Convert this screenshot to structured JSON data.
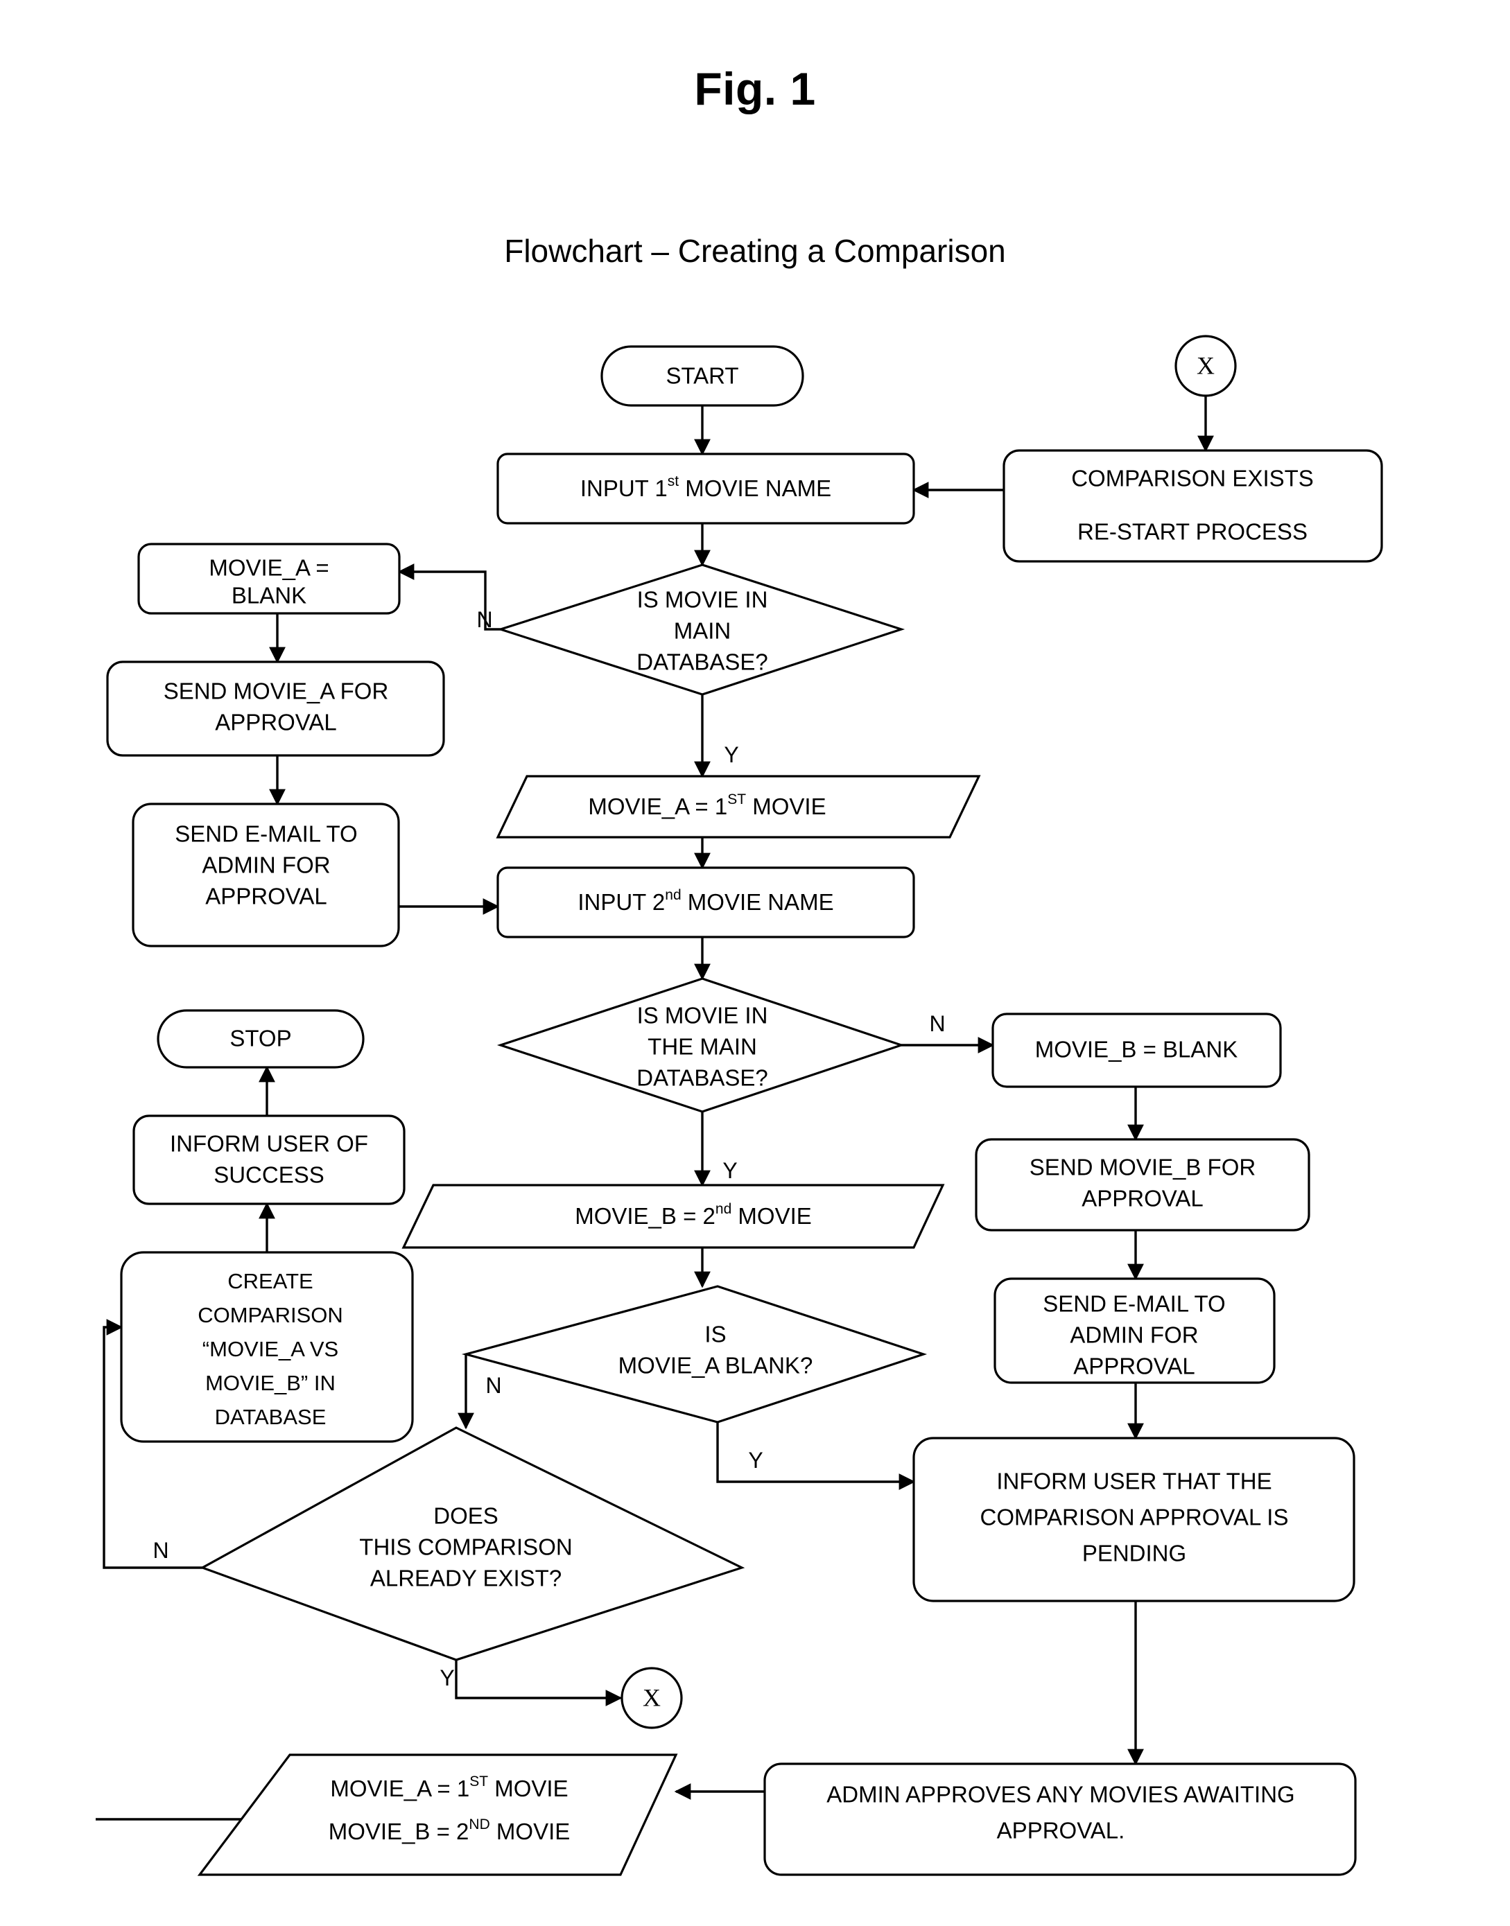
{
  "figure": {
    "label": "Fig. 1",
    "title": "Flowchart – Creating a Comparison"
  },
  "chart_data": {
    "type": "diagram",
    "diagram_kind": "flowchart",
    "title": "Flowchart – Creating a Comparison",
    "figure_label": "Fig. 1",
    "nodes": [
      {
        "id": "start",
        "shape": "terminator",
        "text": "START"
      },
      {
        "id": "connector_x_top",
        "shape": "connector",
        "text": "X"
      },
      {
        "id": "input1",
        "shape": "process",
        "text": "INPUT 1st MOVIE NAME"
      },
      {
        "id": "comparison_exists",
        "shape": "process",
        "text": "COMPARISON EXISTS\nRE-START PROCESS"
      },
      {
        "id": "dec_movie_main_1",
        "shape": "decision",
        "text": "IS MOVIE IN MAIN DATABASE?"
      },
      {
        "id": "movie_a_blank",
        "shape": "process",
        "text": "MOVIE_A = BLANK"
      },
      {
        "id": "send_a_approval",
        "shape": "process",
        "text": "SEND MOVIE_A FOR APPROVAL"
      },
      {
        "id": "email_admin_a",
        "shape": "process",
        "text": "SEND E-MAIL TO ADMIN FOR APPROVAL"
      },
      {
        "id": "assign_a",
        "shape": "data",
        "text": "MOVIE_A = 1ST MOVIE"
      },
      {
        "id": "input2",
        "shape": "process",
        "text": "INPUT 2nd MOVIE NAME"
      },
      {
        "id": "dec_movie_main_2",
        "shape": "decision",
        "text": "IS MOVIE IN THE MAIN DATABASE?"
      },
      {
        "id": "movie_b_blank",
        "shape": "process",
        "text": "MOVIE_B = BLANK"
      },
      {
        "id": "send_b_approval",
        "shape": "process",
        "text": "SEND MOVIE_B FOR APPROVAL"
      },
      {
        "id": "email_admin_b",
        "shape": "process",
        "text": "SEND E-MAIL TO ADMIN FOR APPROVAL"
      },
      {
        "id": "assign_b",
        "shape": "data",
        "text": "MOVIE_B = 2nd MOVIE"
      },
      {
        "id": "dec_a_blank",
        "shape": "decision",
        "text": "IS MOVIE_A BLANK?"
      },
      {
        "id": "dec_comparison",
        "shape": "decision",
        "text": "DOES THIS COMPARISON ALREADY EXIST?"
      },
      {
        "id": "create_comparison",
        "shape": "process",
        "text": "CREATE COMPARISON “MOVIE_A VS MOVIE_B” IN DATABASE"
      },
      {
        "id": "inform_success",
        "shape": "process",
        "text": "INFORM USER OF SUCCESS"
      },
      {
        "id": "stop",
        "shape": "terminator",
        "text": "STOP"
      },
      {
        "id": "inform_pending",
        "shape": "process",
        "text": "INFORM USER THAT THE COMPARISON APPROVAL IS PENDING"
      },
      {
        "id": "connector_x_bot",
        "shape": "connector",
        "text": "X"
      },
      {
        "id": "admin_approves",
        "shape": "process",
        "text": "ADMIN APPROVES ANY MOVIES AWAITING APPROVAL."
      },
      {
        "id": "final_assign",
        "shape": "data",
        "text": "MOVIE_A = 1ST MOVIE\nMOVIE_B = 2ND MOVIE"
      }
    ],
    "edges": [
      {
        "from": "start",
        "to": "input1",
        "label": ""
      },
      {
        "from": "connector_x_top",
        "to": "comparison_exists",
        "label": ""
      },
      {
        "from": "comparison_exists",
        "to": "input1",
        "label": ""
      },
      {
        "from": "input1",
        "to": "dec_movie_main_1",
        "label": ""
      },
      {
        "from": "dec_movie_main_1",
        "to": "movie_a_blank",
        "label": "N"
      },
      {
        "from": "dec_movie_main_1",
        "to": "assign_a",
        "label": "Y"
      },
      {
        "from": "movie_a_blank",
        "to": "send_a_approval",
        "label": ""
      },
      {
        "from": "send_a_approval",
        "to": "email_admin_a",
        "label": ""
      },
      {
        "from": "email_admin_a",
        "to": "input2",
        "label": ""
      },
      {
        "from": "assign_a",
        "to": "input2",
        "label": ""
      },
      {
        "from": "input2",
        "to": "dec_movie_main_2",
        "label": ""
      },
      {
        "from": "dec_movie_main_2",
        "to": "movie_b_blank",
        "label": "N"
      },
      {
        "from": "dec_movie_main_2",
        "to": "assign_b",
        "label": "Y"
      },
      {
        "from": "movie_b_blank",
        "to": "send_b_approval",
        "label": ""
      },
      {
        "from": "send_b_approval",
        "to": "email_admin_b",
        "label": ""
      },
      {
        "from": "email_admin_b",
        "to": "inform_pending",
        "label": ""
      },
      {
        "from": "assign_b",
        "to": "dec_a_blank",
        "label": ""
      },
      {
        "from": "dec_a_blank",
        "to": "dec_comparison",
        "label": "N"
      },
      {
        "from": "dec_a_blank",
        "to": "inform_pending",
        "label": "Y"
      },
      {
        "from": "dec_comparison",
        "to": "create_comparison",
        "label": "N"
      },
      {
        "from": "dec_comparison",
        "to": "connector_x_bot",
        "label": "Y"
      },
      {
        "from": "create_comparison",
        "to": "inform_success",
        "label": ""
      },
      {
        "from": "inform_success",
        "to": "stop",
        "label": ""
      },
      {
        "from": "inform_pending",
        "to": "admin_approves",
        "label": ""
      },
      {
        "from": "admin_approves",
        "to": "final_assign",
        "label": ""
      }
    ],
    "branch_labels": [
      "Y",
      "N"
    ]
  },
  "nodes": {
    "start": "START",
    "connector_x_top": "X",
    "connector_x_bottom": "X",
    "input1_pre": "INPUT 1",
    "input1_sup": "st",
    "input1_post": " MOVIE NAME",
    "comparison_exists_l1": "COMPARISON EXISTS",
    "comparison_exists_l2": "RE-START PROCESS",
    "dec1_l1": "IS MOVIE IN",
    "dec1_l2": "MAIN",
    "dec1_l3": "DATABASE?",
    "movie_a_blank_l1": "MOVIE_A =",
    "movie_a_blank_l2": "BLANK",
    "send_a_l1": "SEND MOVIE_A FOR",
    "send_a_l2": "APPROVAL",
    "email_a_l1": "SEND E-MAIL TO",
    "email_a_l2": "ADMIN FOR",
    "email_a_l3": "APPROVAL",
    "assign_a_pre": "MOVIE_A = 1",
    "assign_a_sup": "ST",
    "assign_a_post": " MOVIE",
    "input2_pre": "INPUT 2",
    "input2_sup": "nd",
    "input2_post": " MOVIE NAME",
    "dec2_l1": "IS MOVIE IN",
    "dec2_l2": "THE MAIN",
    "dec2_l3": "DATABASE?",
    "movie_b_blank": "MOVIE_B = BLANK",
    "send_b_l1": "SEND MOVIE_B FOR",
    "send_b_l2": "APPROVAL",
    "email_b_l1": "SEND E-MAIL TO",
    "email_b_l2": "ADMIN FOR",
    "email_b_l3": "APPROVAL",
    "assign_b_pre": "MOVIE_B = 2",
    "assign_b_sup": "nd",
    "assign_b_post": " MOVIE",
    "dec3_l1": "IS",
    "dec3_l2": "MOVIE_A BLANK?",
    "dec4_l1": "DOES",
    "dec4_l2": "THIS COMPARISON",
    "dec4_l3": "ALREADY EXIST?",
    "create_l1": "CREATE",
    "create_l2": "COMPARISON",
    "create_l3": "“MOVIE_A VS",
    "create_l4": "MOVIE_B” IN",
    "create_l5": "DATABASE",
    "inform_success_l1": "INFORM USER OF",
    "inform_success_l2": "SUCCESS",
    "stop": "STOP",
    "inform_pending_l1": "INFORM USER THAT THE",
    "inform_pending_l2": "COMPARISON APPROVAL IS",
    "inform_pending_l3": "PENDING",
    "admin_approves_l1": "ADMIN APPROVES ANY MOVIES AWAITING",
    "admin_approves_l2": "APPROVAL.",
    "final_a_pre": "MOVIE_A = 1",
    "final_a_sup": "ST",
    "final_a_post": " MOVIE",
    "final_b_pre": "MOVIE_B = 2",
    "final_b_sup": "ND",
    "final_b_post": " MOVIE"
  },
  "labels": {
    "n1": "N",
    "y1": "Y",
    "n2": "N",
    "y2": "Y",
    "n3": "N",
    "y3": "Y",
    "n4": "N",
    "y4": "Y"
  },
  "colors": {
    "stroke": "#000000",
    "fill": "#ffffff",
    "background": "#ffffff"
  }
}
